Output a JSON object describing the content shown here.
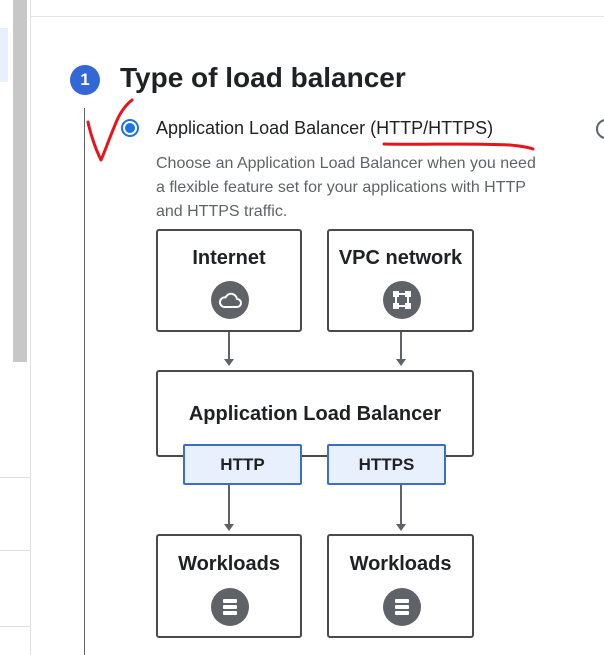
{
  "step": {
    "number": "1",
    "title": "Type of load balancer"
  },
  "option": {
    "label": "Application Load Balancer (HTTP/HTTPS)",
    "description": "Choose an Application Load Balancer when you need a flexible feature set for your applications with HTTP and HTTPS traffic.",
    "selected": true
  },
  "diagram": {
    "sources": [
      {
        "label": "Internet",
        "icon": "cloud-icon"
      },
      {
        "label": "VPC network",
        "icon": "vpc-network-icon"
      }
    ],
    "balancer": {
      "label": "Application Load Balancer"
    },
    "protocols": [
      {
        "label": "HTTP"
      },
      {
        "label": "HTTPS"
      }
    ],
    "targets": [
      {
        "label": "Workloads",
        "icon": "storage-icon"
      },
      {
        "label": "Workloads",
        "icon": "storage-icon"
      }
    ]
  },
  "colors": {
    "accent": "#1a73e8",
    "badge": "#3367d6",
    "protocol_border": "#3b6fc7",
    "protocol_fill": "#e8f0fe",
    "annotation": "#e8141c"
  }
}
